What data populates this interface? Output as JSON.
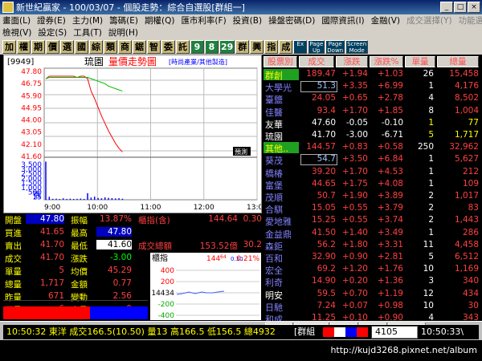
{
  "window": {
    "title": "新世紀贏家 - 100/03/07 - 個股走勢：綜合自選股[群組一]",
    "min": "_",
    "max": "□",
    "close": "×"
  },
  "menu": {
    "row1": [
      "畫面(L)",
      "證券(E)",
      "主力(M)",
      "籌碼(E)",
      "期權(Q)",
      "匯市利率(F)",
      "投資(B)",
      "操盤密碼(D)",
      "國際資訊(I)",
      "金融(V)",
      "成交選擇(Y)",
      "功能選擇(Z)"
    ],
    "row2": [
      "檢視(V)",
      "設定(S)",
      "工具(T)",
      "說明(H)"
    ]
  },
  "toolbar": [
    "加",
    "權",
    "期",
    "價",
    "選",
    "國",
    "綜",
    "類",
    "商",
    "鋸",
    "智",
    "委",
    "託",
    "9",
    "8",
    "29",
    "群",
    "興",
    "指",
    "成",
    "Ex",
    "Page\nUp",
    "Page\nDown",
    "Screen\nMode"
  ],
  "chart": {
    "code": "9949",
    "stock": "琉園",
    "title": "量價走勢圖",
    "sector": "[時尚產業/其他製造]",
    "tag": "預測",
    "vol_label": "張",
    "y_price": [
      "47.80",
      "46.75",
      "45.90",
      "44.95",
      "44.00",
      "43.05",
      "42.10",
      "41.60"
    ],
    "y_vol": [
      "3,500",
      "3,000",
      "2,500",
      "2,000",
      "1,500",
      "1,000",
      "500",
      "15"
    ],
    "x_labels": [
      "9:00",
      "10:00",
      "11:00",
      "12:00",
      "13:00"
    ]
  },
  "chart_data": {
    "type": "line",
    "x": [
      "9:00",
      "9:05",
      "9:10",
      "9:15",
      "9:20",
      "9:25",
      "9:30",
      "9:35",
      "9:40",
      "9:45",
      "9:50",
      "9:55",
      "10:00",
      "10:05",
      "10:10",
      "10:15",
      "10:20",
      "10:25",
      "10:30",
      "10:35",
      "10:40",
      "10:45",
      "10:50"
    ],
    "series": [
      {
        "values": [
          47.6,
          47.8,
          47.8,
          47.8,
          47.8,
          47.8,
          47.8,
          47.8,
          47.8,
          47.7,
          47.8,
          47.8,
          47.6,
          46.6,
          46.0,
          45.3,
          44.6,
          44.0,
          43.4,
          42.9,
          42.4,
          42.0,
          41.7
        ]
      },
      {
        "values": [
          47.6,
          47.7,
          47.7,
          47.7,
          47.7,
          47.7,
          47.7,
          47.7,
          47.7,
          47.7,
          47.7,
          47.7,
          47.7,
          47.6,
          47.5,
          47.4,
          47.3,
          47.2,
          47.0,
          46.9,
          46.8,
          46.7,
          46.6
        ]
      }
    ],
    "volume": [
      3200,
      250,
      80,
      90,
      60,
      120,
      70,
      90,
      60,
      80,
      100,
      70,
      550,
      180,
      260,
      150,
      120,
      200,
      160,
      140,
      110,
      130,
      90
    ],
    "ylim": [
      41.6,
      47.8
    ]
  },
  "quote": {
    "rows": [
      {
        "l1": "開盤",
        "v1": "47.80",
        "l2": "振幅",
        "v2": "13.87%",
        "l3": "櫃指(含)",
        "v3": "144.64",
        "v4": "0.30"
      },
      {
        "l1": "買進",
        "v1": "41.65",
        "l2": "最高",
        "v2": "47.80"
      },
      {
        "l1": "賣出",
        "v1": "41.70",
        "l2": "最低",
        "v2": "41.60",
        "l3": "成交總額",
        "v3": "153.52億",
        "v4": "30.2"
      },
      {
        "l1": "成交",
        "v1": "41.70",
        "l2": "漲跌",
        "v2": "-3.00"
      },
      {
        "l1": "單量",
        "v1": "5",
        "l2": "均價",
        "v2": "45.29"
      },
      {
        "l1": "總量",
        "v1": "1,717",
        "l2": "金額",
        "v2": "0.77"
      },
      {
        "l1": "昨量",
        "v1": "671",
        "l2": "變動",
        "v2": "2.56"
      },
      {
        "l1": "買量",
        "v1": "6",
        "l2": "賣量",
        "v2": "9"
      }
    ]
  },
  "mini": {
    "label": "櫃指",
    "value": "144",
    "value_sup": "64",
    "change": "0.30",
    "pct": "0.21%",
    "y": [
      "400",
      "200",
      "14434",
      "-200",
      "-400"
    ]
  },
  "right": {
    "headers": [
      "股票別",
      "成交",
      "漲跌",
      "漲跌%",
      "單量",
      "總量"
    ],
    "rows": [
      {
        "name": "群創",
        "price": "189.47",
        "chg": "+1.94",
        "pct": "+1.03",
        "vol": "26",
        "total": "15,458",
        "nc": "#ffff00",
        "hl": "#20a020"
      },
      {
        "name": "大學光",
        "price": "51.3",
        "chg": "+3.35",
        "pct": "+6.99",
        "vol": "1",
        "total": "4,176",
        "nc": "#8080ff",
        "box": true
      },
      {
        "name": "臺鹽",
        "price": "24.05",
        "chg": "+0.65",
        "pct": "+2.78",
        "vol": "4",
        "total": "8,502",
        "nc": "#8080ff"
      },
      {
        "name": "佳醫",
        "price": "93.4",
        "chg": "+1.70",
        "pct": "+1.85",
        "vol": "8",
        "total": "1,004",
        "nc": "#8080ff"
      },
      {
        "name": "友華",
        "price": "47.60",
        "chg": "-0.05",
        "pct": "-0.10",
        "vol": "1",
        "total": "77",
        "nc": "#ffffff",
        "w": true
      },
      {
        "name": "琉園",
        "price": "41.70",
        "chg": "-3.00",
        "pct": "-6.71",
        "vol": "5",
        "total": "1,717",
        "nc": "#ffffff",
        "w": true
      },
      {
        "name": "其他..",
        "price": "144.57",
        "chg": "+0.83",
        "pct": "+0.58",
        "vol": "250",
        "total": "32,962",
        "nc": "#ffff00",
        "hl": "#20a020"
      },
      {
        "name": "葵茂",
        "price": "54.7",
        "chg": "+3.50",
        "pct": "+6.84",
        "vol": "1",
        "total": "5,627",
        "nc": "#8080ff",
        "box": true
      },
      {
        "name": "橋椿",
        "price": "39.20",
        "chg": "+1.70",
        "pct": "+4.53",
        "vol": "1",
        "total": "212",
        "nc": "#8080ff"
      },
      {
        "name": "富堡",
        "price": "44.65",
        "chg": "+1.75",
        "pct": "+4.08",
        "vol": "1",
        "total": "109",
        "nc": "#8080ff"
      },
      {
        "name": "茂順",
        "price": "50.7",
        "chg": "+1.90",
        "pct": "+3.89",
        "vol": "2",
        "total": "1,017",
        "nc": "#8080ff"
      },
      {
        "name": "合騏",
        "price": "15.05",
        "chg": "+0.55",
        "pct": "+3.79",
        "vol": "2",
        "total": "83",
        "nc": "#8080ff"
      },
      {
        "name": "愛地雅",
        "price": "15.25",
        "chg": "+0.55",
        "pct": "+3.74",
        "vol": "2",
        "total": "1,443",
        "nc": "#8080ff"
      },
      {
        "name": "金益鼎",
        "price": "41.50",
        "chg": "+1.40",
        "pct": "+3.49",
        "vol": "1",
        "total": "286",
        "nc": "#8080ff"
      },
      {
        "name": "森鉅",
        "price": "56.2",
        "chg": "+1.80",
        "pct": "+3.31",
        "vol": "11",
        "total": "4,458",
        "nc": "#8080ff"
      },
      {
        "name": "百和",
        "price": "32.90",
        "chg": "+0.90",
        "pct": "+2.81",
        "vol": "5",
        "total": "6,512",
        "nc": "#8080ff"
      },
      {
        "name": "宏全",
        "price": "69.2",
        "chg": "+1.20",
        "pct": "+1.76",
        "vol": "10",
        "total": "1,169",
        "nc": "#8080ff"
      },
      {
        "name": "利奇",
        "price": "14.90",
        "chg": "+0.20",
        "pct": "+1.36",
        "vol": "3",
        "total": "340",
        "nc": "#8080ff"
      },
      {
        "name": "明安",
        "price": "59.5",
        "chg": "+0.70",
        "pct": "+1.19",
        "vol": "12",
        "total": "434",
        "nc": "#ffffff"
      },
      {
        "name": "日馳",
        "price": "7.24",
        "chg": "+0.07",
        "pct": "+0.98",
        "vol": "10",
        "total": "30",
        "nc": "#8080ff"
      },
      {
        "name": "和成",
        "price": "11.25",
        "chg": "+0.10",
        "pct": "+0.90",
        "vol": "4",
        "total": "343",
        "nc": "#8080ff"
      }
    ]
  },
  "status": {
    "tabs": [
      "產業別",
      "個股排行",
      "概念股",
      "集團股",
      "標的/權證"
    ],
    "ticker": "10:50:32 東洋 成交166.5(10.50) 量13 高166.5 低156.5 總4932",
    "group": "[群組",
    "code_input": "4105",
    "clock": "10:50:33\\"
  },
  "footer": {
    "url": "http://kujd3268.pixnet.net/album"
  },
  "colors": {
    "up": "#ff4040",
    "down": "#00ff00",
    "flat": "#ffffff",
    "name": "#8080ff",
    "yellow": "#ffff00"
  }
}
